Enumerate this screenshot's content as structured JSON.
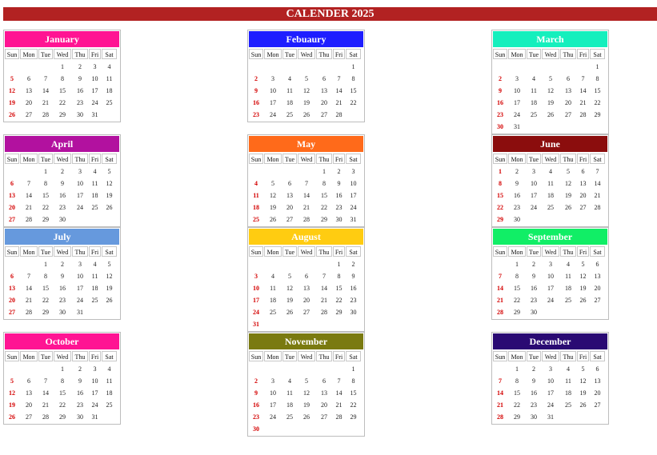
{
  "title": "CALENDER 2025",
  "weekdays": [
    "Sun",
    "Mon",
    "Tue",
    "Wed",
    "Thu",
    "Fri",
    "Sat"
  ],
  "months": [
    {
      "name": "January",
      "color": "#ff1493",
      "start": 3,
      "days": 31
    },
    {
      "name": "Febuaury",
      "color": "#1e1eff",
      "start": 6,
      "days": 28
    },
    {
      "name": "March",
      "color": "#15efbd",
      "start": 6,
      "days": 31
    },
    {
      "name": "April",
      "color": "#b2119f",
      "start": 2,
      "days": 30
    },
    {
      "name": "May",
      "color": "#ff6a1a",
      "start": 4,
      "days": 31
    },
    {
      "name": "June",
      "color": "#8b0d0d",
      "start": 0,
      "days": 30
    },
    {
      "name": "July",
      "color": "#6699dd",
      "start": 2,
      "days": 31
    },
    {
      "name": "August",
      "color": "#ffcc11",
      "start": 5,
      "days": 31
    },
    {
      "name": "September",
      "color": "#11ee66",
      "start": 1,
      "days": 30
    },
    {
      "name": "October",
      "color": "#ff1493",
      "start": 3,
      "days": 31
    },
    {
      "name": "November",
      "color": "#7a7a10",
      "start": 6,
      "days": 30
    },
    {
      "name": "December",
      "color": "#2a0a73",
      "start": 1,
      "days": 31
    }
  ]
}
